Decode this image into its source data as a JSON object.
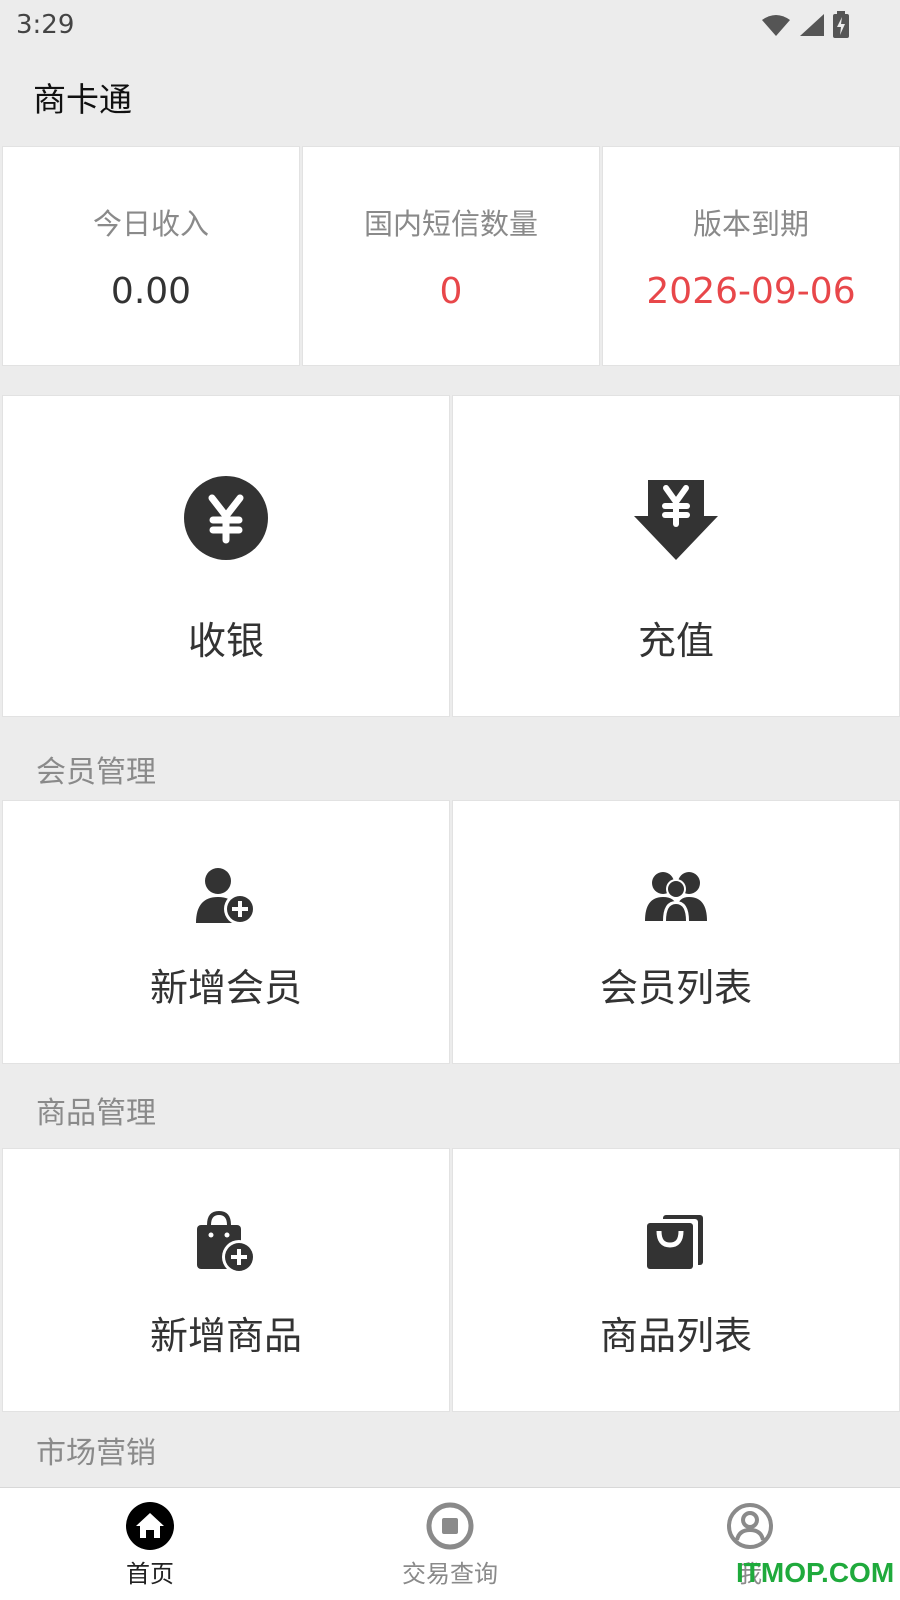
{
  "status_bar": {
    "time": "3:29"
  },
  "app_bar": {
    "title": "商卡通"
  },
  "stats": [
    {
      "label": "今日收入",
      "value": "0.00"
    },
    {
      "label": "国内短信数量",
      "value": "0"
    },
    {
      "label": "版本到期",
      "value": "2026-09-06"
    }
  ],
  "quick_actions": {
    "cashier": {
      "label": "收银",
      "icon": "yen-circle-icon"
    },
    "recharge": {
      "label": "充值",
      "icon": "yen-down-arrow-icon"
    }
  },
  "member_section": {
    "title": "会员管理",
    "add_member": {
      "label": "新增会员",
      "icon": "add-user-icon"
    },
    "member_list": {
      "label": "会员列表",
      "icon": "users-icon"
    }
  },
  "product_section": {
    "title": "商品管理",
    "add_product": {
      "label": "新增商品",
      "icon": "add-bag-icon"
    },
    "product_list": {
      "label": "商品列表",
      "icon": "bags-icon"
    }
  },
  "marketing_section": {
    "title": "市场营销"
  },
  "bottom_nav": [
    {
      "label": "首页",
      "icon": "home-icon",
      "active": true
    },
    {
      "label": "交易查询",
      "icon": "stop-circle-icon",
      "active": false
    },
    {
      "label": "我",
      "icon": "user-circle-icon",
      "active": false
    }
  ],
  "watermark": "ITMOP.COM",
  "colors": {
    "accent_red": "#e8474a",
    "icon_dark": "#333333",
    "muted_text": "#8a8a8a",
    "watermark_green": "#1faa3c"
  }
}
